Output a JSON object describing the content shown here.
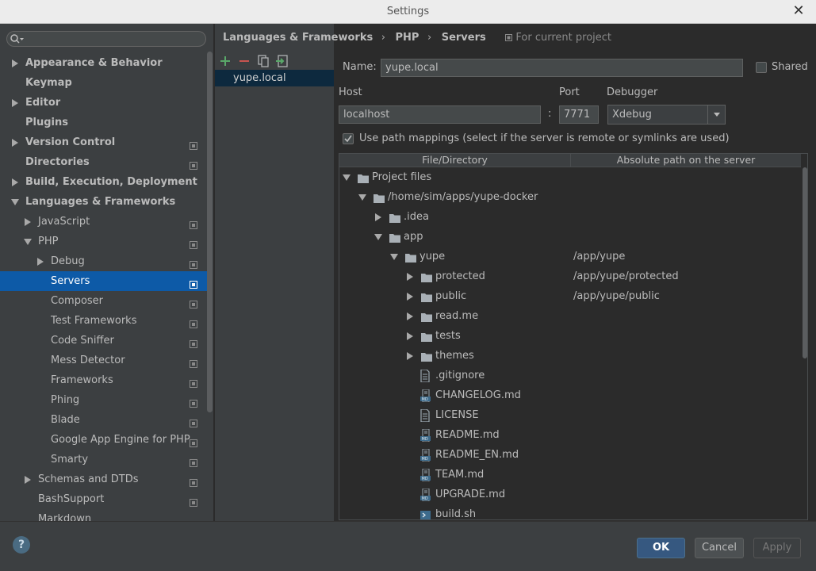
{
  "window": {
    "title": "Settings"
  },
  "sidebar": {
    "search_placeholder": "",
    "items": [
      {
        "label": "Appearance & Behavior",
        "level": 0,
        "bold": true,
        "arrow": "right",
        "project": false,
        "selected": false
      },
      {
        "label": "Keymap",
        "level": 0,
        "bold": true,
        "arrow": "none",
        "project": false,
        "selected": false
      },
      {
        "label": "Editor",
        "level": 0,
        "bold": true,
        "arrow": "right",
        "project": false,
        "selected": false
      },
      {
        "label": "Plugins",
        "level": 0,
        "bold": true,
        "arrow": "none",
        "project": false,
        "selected": false
      },
      {
        "label": "Version Control",
        "level": 0,
        "bold": true,
        "arrow": "right",
        "project": true,
        "selected": false
      },
      {
        "label": "Directories",
        "level": 0,
        "bold": true,
        "arrow": "none",
        "project": true,
        "selected": false
      },
      {
        "label": "Build, Execution, Deployment",
        "level": 0,
        "bold": true,
        "arrow": "right",
        "project": false,
        "selected": false
      },
      {
        "label": "Languages & Frameworks",
        "level": 0,
        "bold": true,
        "arrow": "down",
        "project": false,
        "selected": false
      },
      {
        "label": "JavaScript",
        "level": 1,
        "bold": false,
        "arrow": "right",
        "project": true,
        "selected": false
      },
      {
        "label": "PHP",
        "level": 1,
        "bold": false,
        "arrow": "down",
        "project": true,
        "selected": false
      },
      {
        "label": "Debug",
        "level": 2,
        "bold": false,
        "arrow": "right",
        "project": true,
        "selected": false
      },
      {
        "label": "Servers",
        "level": 2,
        "bold": false,
        "arrow": "none",
        "project": true,
        "selected": true
      },
      {
        "label": "Composer",
        "level": 2,
        "bold": false,
        "arrow": "none",
        "project": true,
        "selected": false
      },
      {
        "label": "Test Frameworks",
        "level": 2,
        "bold": false,
        "arrow": "none",
        "project": true,
        "selected": false
      },
      {
        "label": "Code Sniffer",
        "level": 2,
        "bold": false,
        "arrow": "none",
        "project": true,
        "selected": false
      },
      {
        "label": "Mess Detector",
        "level": 2,
        "bold": false,
        "arrow": "none",
        "project": true,
        "selected": false
      },
      {
        "label": "Frameworks",
        "level": 2,
        "bold": false,
        "arrow": "none",
        "project": true,
        "selected": false
      },
      {
        "label": "Phing",
        "level": 2,
        "bold": false,
        "arrow": "none",
        "project": true,
        "selected": false
      },
      {
        "label": "Blade",
        "level": 2,
        "bold": false,
        "arrow": "none",
        "project": true,
        "selected": false
      },
      {
        "label": "Google App Engine for PHP",
        "level": 2,
        "bold": false,
        "arrow": "none",
        "project": true,
        "selected": false
      },
      {
        "label": "Smarty",
        "level": 2,
        "bold": false,
        "arrow": "none",
        "project": true,
        "selected": false
      },
      {
        "label": "Schemas and DTDs",
        "level": 1,
        "bold": false,
        "arrow": "right",
        "project": true,
        "selected": false
      },
      {
        "label": "BashSupport",
        "level": 1,
        "bold": false,
        "arrow": "none",
        "project": true,
        "selected": false
      },
      {
        "label": "Markdown",
        "level": 1,
        "bold": false,
        "arrow": "none",
        "project": false,
        "selected": false
      }
    ]
  },
  "servers": {
    "items": [
      "yupe.local"
    ]
  },
  "breadcrumb": {
    "parts": [
      "Languages & Frameworks",
      "PHP",
      "Servers"
    ],
    "separator": "›",
    "scope": "For current project"
  },
  "form": {
    "name_label": "Name:",
    "name_value": "yupe.local",
    "shared_label": "Shared",
    "host_label": "Host",
    "host_value": "localhost",
    "colon": ":",
    "port_label": "Port",
    "port_value": "7771",
    "debugger_label": "Debugger",
    "debugger_value": "Xdebug",
    "mappings_label": "Use path mappings (select if the server is remote or symlinks are used)"
  },
  "mapping_table": {
    "col1": "File/Directory",
    "col2": "Absolute path on the server",
    "rows": [
      {
        "name": "Project files",
        "indent": 0,
        "arrow": "down",
        "icon": "folder",
        "path": ""
      },
      {
        "name": "/home/sim/apps/yupe-docker",
        "indent": 1,
        "arrow": "down",
        "icon": "folder",
        "path": ""
      },
      {
        "name": ".idea",
        "indent": 2,
        "arrow": "right",
        "icon": "folder",
        "path": ""
      },
      {
        "name": "app",
        "indent": 2,
        "arrow": "down",
        "icon": "folder",
        "path": ""
      },
      {
        "name": "yupe",
        "indent": 3,
        "arrow": "down",
        "icon": "folder",
        "path": "/app/yupe"
      },
      {
        "name": "protected",
        "indent": 4,
        "arrow": "right",
        "icon": "folder",
        "path": "/app/yupe/protected"
      },
      {
        "name": "public",
        "indent": 4,
        "arrow": "right",
        "icon": "folder",
        "path": "/app/yupe/public"
      },
      {
        "name": "read.me",
        "indent": 4,
        "arrow": "right",
        "icon": "folder",
        "path": ""
      },
      {
        "name": "tests",
        "indent": 4,
        "arrow": "right",
        "icon": "folder",
        "path": ""
      },
      {
        "name": "themes",
        "indent": 4,
        "arrow": "right",
        "icon": "folder",
        "path": ""
      },
      {
        "name": ".gitignore",
        "indent": 4,
        "arrow": "none",
        "icon": "file",
        "path": ""
      },
      {
        "name": "CHANGELOG.md",
        "indent": 4,
        "arrow": "none",
        "icon": "md",
        "path": ""
      },
      {
        "name": "LICENSE",
        "indent": 4,
        "arrow": "none",
        "icon": "file",
        "path": ""
      },
      {
        "name": "README.md",
        "indent": 4,
        "arrow": "none",
        "icon": "md",
        "path": ""
      },
      {
        "name": "README_EN.md",
        "indent": 4,
        "arrow": "none",
        "icon": "md",
        "path": ""
      },
      {
        "name": "TEAM.md",
        "indent": 4,
        "arrow": "none",
        "icon": "md",
        "path": ""
      },
      {
        "name": "UPGRADE.md",
        "indent": 4,
        "arrow": "none",
        "icon": "md",
        "path": ""
      },
      {
        "name": "build.sh",
        "indent": 4,
        "arrow": "none",
        "icon": "sh",
        "path": ""
      }
    ]
  },
  "buttons": {
    "help": "?",
    "ok": "OK",
    "cancel": "Cancel",
    "apply": "Apply"
  }
}
